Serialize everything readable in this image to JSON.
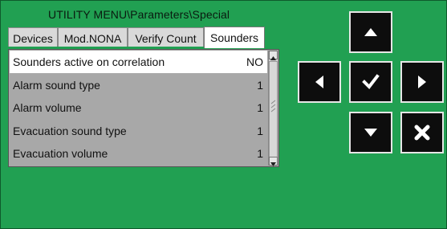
{
  "header": {
    "title": "UTILITY MENU\\Parameters\\Special"
  },
  "tabs": [
    {
      "label": "Devices"
    },
    {
      "label": "Mod.NONA"
    },
    {
      "label": "Verify Count"
    },
    {
      "label": "Sounders"
    }
  ],
  "active_tab": "Sounders",
  "list": {
    "rows": [
      {
        "label": "Sounders active on correlation",
        "value": "NO",
        "selected": true
      },
      {
        "label": "Alarm sound type",
        "value": "1"
      },
      {
        "label": "Alarm volume",
        "value": "1"
      },
      {
        "label": "Evacuation sound type",
        "value": "1"
      },
      {
        "label": "Evacuation volume",
        "value": "1"
      }
    ]
  },
  "keypad": {
    "up": "up-arrow-icon",
    "left": "left-arrow-icon",
    "ok": "check-icon",
    "right": "right-arrow-icon",
    "down": "down-arrow-icon",
    "cancel": "cancel-icon"
  },
  "colors": {
    "background": "#21a052",
    "button": "#0d0d0d",
    "selected_row": "#ffffff",
    "list_bg": "#a8a8a8"
  }
}
